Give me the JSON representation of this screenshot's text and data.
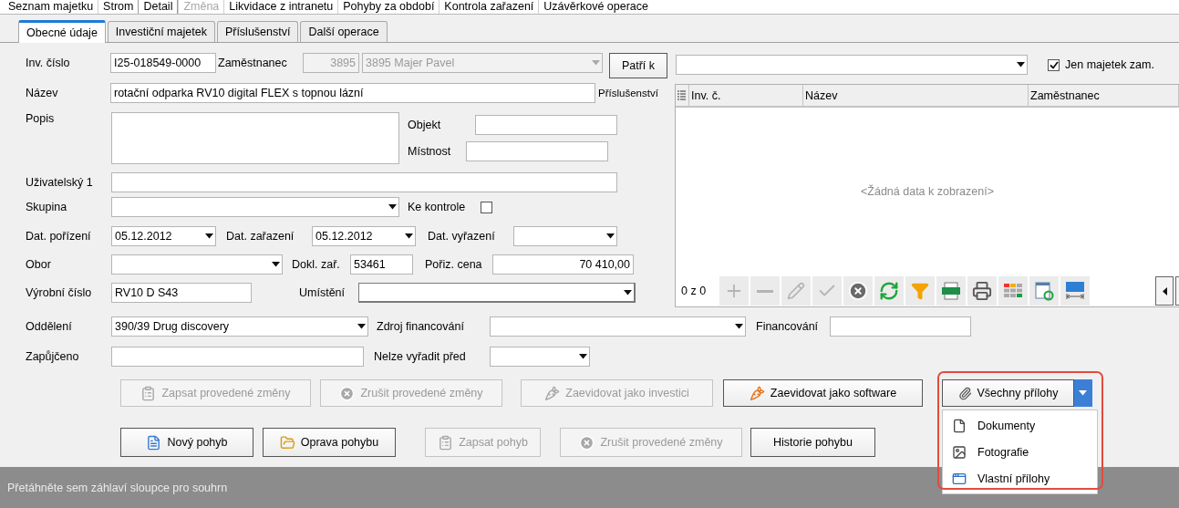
{
  "main_tabs": [
    {
      "label": "Seznam majetku",
      "selected": false,
      "disabled": false
    },
    {
      "label": "Strom",
      "selected": false,
      "disabled": false
    },
    {
      "label": "Detail",
      "selected": true,
      "disabled": false
    },
    {
      "label": "Změna",
      "selected": false,
      "disabled": true
    },
    {
      "label": "Likvidace z intranetu",
      "selected": false,
      "disabled": false
    },
    {
      "label": "Pohyby za období",
      "selected": false,
      "disabled": false
    },
    {
      "label": "Kontrola zařazení",
      "selected": false,
      "disabled": false
    },
    {
      "label": "Uzávěrkové operace",
      "selected": false,
      "disabled": false
    }
  ],
  "sub_tabs": [
    {
      "label": "Obecné údaje",
      "selected": true
    },
    {
      "label": "Investiční majetek",
      "selected": false
    },
    {
      "label": "Příslušenství",
      "selected": false
    },
    {
      "label": "Další operace",
      "selected": false
    }
  ],
  "inv_number": {
    "label": "Inv. číslo",
    "value": "I25-018549-0000"
  },
  "employee": {
    "label": "Zaměstnanec",
    "code": "3895",
    "value": "3895 Majer Pavel",
    "disabled": true
  },
  "belongs_to": {
    "button": "Patří k"
  },
  "only_employee": {
    "label": "Jen majetek zam.",
    "checked": true
  },
  "name": {
    "label": "Název",
    "value": "rotační odparka RV10 digital FLEX s topnou lázní"
  },
  "accessories_label": "Příslušenství",
  "description": {
    "label": "Popis"
  },
  "object": {
    "label": "Objekt"
  },
  "room": {
    "label": "Místnost"
  },
  "user1": {
    "label": "Uživatelský 1"
  },
  "group": {
    "label": "Skupina"
  },
  "to_check": {
    "label": "Ke kontrole",
    "checked": false
  },
  "acquired": {
    "label": "Dat. pořízení",
    "value": "05.12.2012"
  },
  "classified": {
    "label": "Dat. zařazení",
    "value": "05.12.2012"
  },
  "discarded": {
    "label": "Dat. vyřazení"
  },
  "branch": {
    "label": "Obor"
  },
  "doc": {
    "label": "Dokl. zař.",
    "value": "53461"
  },
  "price": {
    "label": "Pořiz. cena",
    "value": "70 410,00"
  },
  "serial": {
    "label": "Výrobní číslo",
    "value": "RV10 D S43"
  },
  "location": {
    "label": "Umístění"
  },
  "department": {
    "label": "Oddělení",
    "value": "390/39 Drug discovery"
  },
  "funding_source": {
    "label": "Zdroj financování"
  },
  "funding": {
    "label": "Financování"
  },
  "lent": {
    "label": "Zapůjčeno"
  },
  "no_discard_before": {
    "label": "Nelze vyřadit před"
  },
  "grid": {
    "columns": [
      "Inv. č.",
      "Název",
      "Zaměstnanec"
    ],
    "empty_text": "<Žádná data k zobrazení>",
    "counter": "0 z 0",
    "tools": [
      {
        "kind": "add",
        "disabled": true
      },
      {
        "kind": "remove",
        "disabled": true
      },
      {
        "kind": "edit",
        "disabled": true
      },
      {
        "kind": "confirm",
        "disabled": true
      },
      {
        "kind": "cancel",
        "disabled": false
      },
      {
        "kind": "refresh",
        "disabled": false
      },
      {
        "kind": "filter",
        "disabled": false
      },
      {
        "kind": "xlsx",
        "disabled": false
      },
      {
        "kind": "print",
        "disabled": false
      },
      {
        "kind": "layout",
        "disabled": false
      },
      {
        "kind": "reload",
        "disabled": false
      },
      {
        "kind": "autowidth",
        "disabled": false
      }
    ]
  },
  "actions": [
    {
      "label": "Zapsat provedené změny",
      "kind": "clipboard",
      "disabled": true
    },
    {
      "label": "Zrušit provedené změny",
      "kind": "cancel",
      "disabled": true
    },
    {
      "label": "Zaevidovat jako investici",
      "kind": "carrot",
      "disabled": true
    },
    {
      "label": "Zaevidovat jako software",
      "kind": "carrot",
      "disabled": false
    }
  ],
  "attachments": {
    "label": "Všechny přílohy",
    "expanded": true,
    "items": [
      {
        "label": "Dokumenty",
        "kind": "document"
      },
      {
        "label": "Fotografie",
        "kind": "photo"
      },
      {
        "label": "Vlastní přílohy",
        "kind": "custom"
      }
    ]
  },
  "movement_actions": [
    {
      "label": "Nový pohyb",
      "kind": "document",
      "disabled": false
    },
    {
      "label": "Oprava pohybu",
      "kind": "folder",
      "disabled": false
    },
    {
      "label": "Zapsat pohyb",
      "kind": "clipboard",
      "disabled": true
    },
    {
      "label": "Zrušit provedené změny",
      "kind": "cancel",
      "disabled": true
    },
    {
      "label": "Historie pohybu",
      "kind": "plain",
      "disabled": false
    }
  ],
  "group_panel": "Přetáhněte sem záhlaví sloupce pro souhrn"
}
